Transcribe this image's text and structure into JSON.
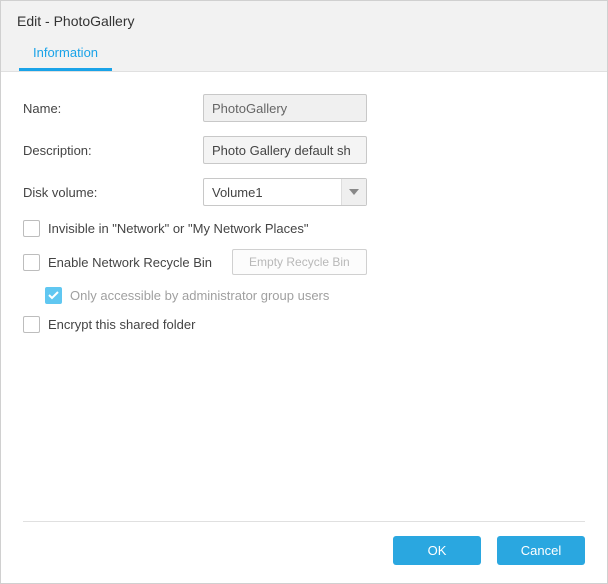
{
  "title": "Edit - PhotoGallery",
  "tabs": {
    "information": "Information"
  },
  "form": {
    "name_label": "Name:",
    "name_value": "PhotoGallery",
    "description_label": "Description:",
    "description_value": "Photo Gallery default sh",
    "volume_label": "Disk volume:",
    "volume_value": "Volume1"
  },
  "checks": {
    "invisible": "Invisible in \"Network\" or \"My Network Places\"",
    "recycle": "Enable Network Recycle Bin",
    "empty_recycle_btn": "Empty Recycle Bin",
    "admin_only": "Only accessible by administrator group users",
    "encrypt": "Encrypt this shared folder"
  },
  "footer": {
    "ok": "OK",
    "cancel": "Cancel"
  }
}
